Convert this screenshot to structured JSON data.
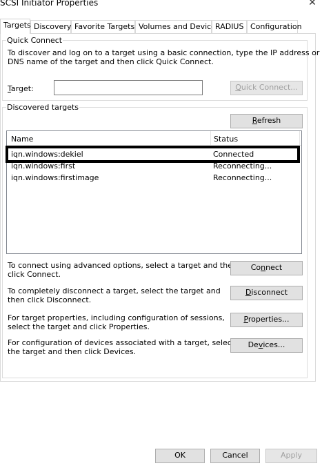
{
  "window": {
    "title": "SCSI Initiator Properties",
    "close_glyph": "✕"
  },
  "tabs": [
    {
      "label": "Targets",
      "active": true
    },
    {
      "label": "Discovery",
      "active": false
    },
    {
      "label": "Favorite Targets",
      "active": false
    },
    {
      "label": "Volumes and Devices",
      "active": false
    },
    {
      "label": "RADIUS",
      "active": false
    },
    {
      "label": "Configuration",
      "active": false
    }
  ],
  "quick_connect": {
    "legend": "Quick Connect",
    "description_line1": "To discover and log on to a target using a basic connection, type the IP address or",
    "description_line2": "DNS name of the target and then click Quick Connect.",
    "target_label_prefix": "",
    "target_label_access": "T",
    "target_label_rest": "arget:",
    "target_value": "",
    "button_access": "Q",
    "button_rest": "uick Connect...",
    "button_enabled": false
  },
  "discovered": {
    "legend": "Discovered targets",
    "refresh_access": "R",
    "refresh_rest": "efresh",
    "columns": [
      "Name",
      "Status"
    ],
    "rows": [
      {
        "name": "iqn.windows:dekiel",
        "status": "Connected"
      },
      {
        "name": "iqn.windows:first",
        "status": "Reconnecting..."
      },
      {
        "name": "iqn.windows:firstimage",
        "status": "Reconnecting..."
      }
    ],
    "highlighted_row": 0
  },
  "actions": {
    "connect": {
      "desc1": "To connect using advanced options, select a target and then",
      "desc2": "click Connect.",
      "label_pre": "Co",
      "label_access": "n",
      "label_post": "nect"
    },
    "disconnect": {
      "desc1": "To completely disconnect a target, select the target and",
      "desc2": "then click Disconnect.",
      "label_pre": "",
      "label_access": "D",
      "label_post": "isconnect"
    },
    "properties": {
      "desc1": "For target properties, including configuration of sessions,",
      "desc2": "select the target and click Properties.",
      "label_pre": "",
      "label_access": "P",
      "label_post": "roperties..."
    },
    "devices": {
      "desc1": "For configuration of devices associated with a target, select",
      "desc2": "the target and then click Devices.",
      "label_pre": "De",
      "label_access": "v",
      "label_post": "ices..."
    }
  },
  "footer": {
    "ok": "OK",
    "cancel": "Cancel",
    "apply": "Apply",
    "apply_enabled": false
  }
}
